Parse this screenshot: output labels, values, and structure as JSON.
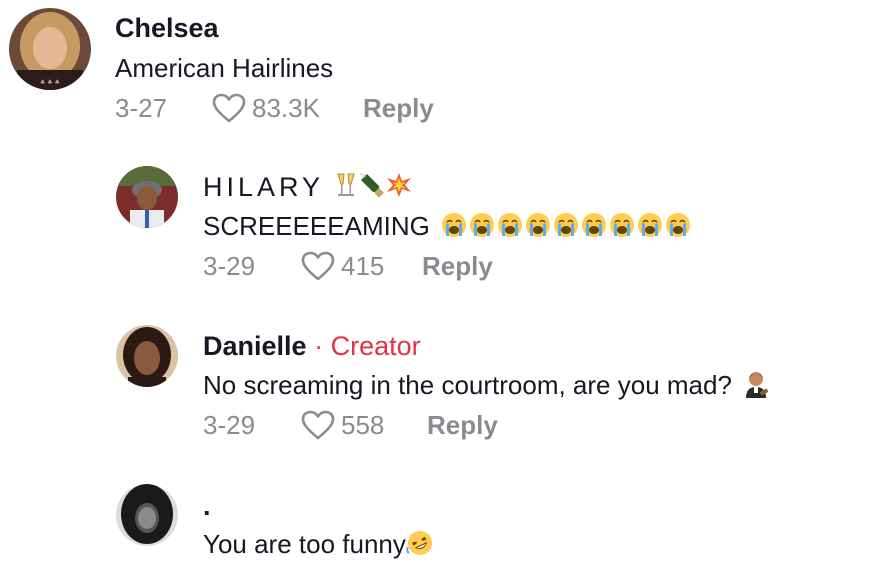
{
  "comments": [
    {
      "author": "Chelsea",
      "text": "American Hairlines",
      "date": "3-27",
      "likes": "83.3K",
      "reply_label": "Reply"
    },
    {
      "author": "HILARY",
      "author_emojis": [
        "clinking-glasses",
        "bottle-popping",
        "collision"
      ],
      "text": "SCREEEEEAMING",
      "text_emoji": "loudly-crying-face",
      "text_emoji_count": 9,
      "date": "3-29",
      "likes": "415",
      "reply_label": "Reply"
    },
    {
      "author": "Danielle",
      "separator": "·",
      "badge": "Creator",
      "badge_color": "#e5304d",
      "text": "No screaming in the courtroom, are you mad?",
      "text_emoji": "judge",
      "date": "3-29",
      "likes": "558",
      "reply_label": "Reply"
    },
    {
      "author": ".",
      "text": "You are too funny",
      "text_emoji": "rolling-on-the-floor-laughing"
    }
  ]
}
